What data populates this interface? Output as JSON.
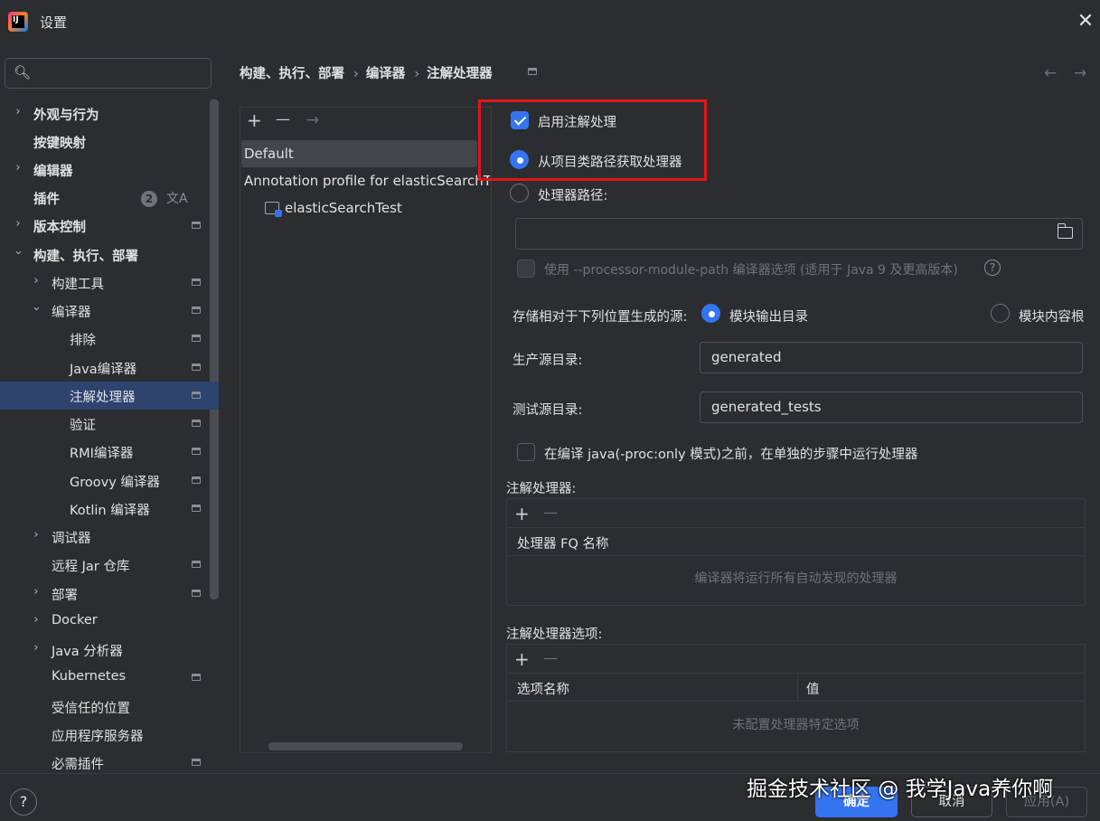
{
  "window": {
    "title": "设置",
    "close_icon": "✕"
  },
  "search": {
    "value": "",
    "placeholder": ""
  },
  "sidebar": {
    "items": [
      {
        "label": "外观与行为"
      },
      {
        "label": "按键映射"
      },
      {
        "label": "编辑器"
      },
      {
        "label": "插件",
        "badge": "2"
      },
      {
        "label": "版本控制"
      },
      {
        "label": "构建、执行、部署"
      },
      {
        "label": "构建工具"
      },
      {
        "label": "编译器"
      },
      {
        "label": "排除"
      },
      {
        "label": "Java编译器"
      },
      {
        "label": "注解处理器"
      },
      {
        "label": "验证"
      },
      {
        "label": "RMI编译器"
      },
      {
        "label": "Groovy 编译器"
      },
      {
        "label": "Kotlin 编译器"
      },
      {
        "label": "调试器"
      },
      {
        "label": "远程 Jar 仓库"
      },
      {
        "label": "部署"
      },
      {
        "label": "Docker"
      },
      {
        "label": "Java 分析器"
      },
      {
        "label": "Kubernetes"
      },
      {
        "label": "受信任的位置"
      },
      {
        "label": "应用程序服务器"
      },
      {
        "label": "必需插件"
      }
    ]
  },
  "breadcrumb": {
    "items": [
      "构建、执行、部署",
      "编译器",
      "注解处理器"
    ],
    "separator": "›"
  },
  "profiles": {
    "toolbar": {
      "add": "+",
      "remove": "—",
      "move": "→"
    },
    "default": "Default",
    "annotation_profile": "Annotation profile for elasticSearchTest",
    "module": "elasticSearchTest"
  },
  "settings": {
    "enable_processing": {
      "label": "启用注解处理",
      "checked": true
    },
    "from_classpath": {
      "label": "从项目类路径获取处理器",
      "selected": true
    },
    "processor_path": {
      "label": "处理器路径:",
      "selected": false,
      "value": ""
    },
    "module_path_option": {
      "label": "使用 --processor-module-path 编译器选项 (适用于 Java 9 及更高版本)",
      "checked": false,
      "enabled": false
    },
    "store_generated": {
      "label": "存储相对于下列位置生成的源:",
      "options": [
        {
          "label": "模块输出目录",
          "selected": true
        },
        {
          "label": "模块内容根",
          "selected": false
        }
      ]
    },
    "prod_dir": {
      "label": "生产源目录:",
      "value": "generated"
    },
    "test_dir": {
      "label": "测试源目录:",
      "value": "generated_tests"
    },
    "separate_step": {
      "label": "在编译 java(-proc:only 模式)之前，在单独的步骤中运行处理器",
      "checked": false
    }
  },
  "processors_table": {
    "title": "注解处理器:",
    "column": "处理器 FQ 名称",
    "empty_text": "编译器将运行所有自动发现的处理器"
  },
  "options_table": {
    "title": "注解处理器选项:",
    "columns": [
      "选项名称",
      "值"
    ],
    "empty_text": "未配置处理器特定选项"
  },
  "buttons": {
    "help": "?",
    "ok": "确定",
    "cancel": "取消",
    "apply": "应用(A)"
  },
  "watermark": "掘金技术社区 @ 我学Java养你啊",
  "colors": {
    "accent": "#3574f0",
    "highlight_box": "#e0151b",
    "selection": "#2e436e"
  }
}
